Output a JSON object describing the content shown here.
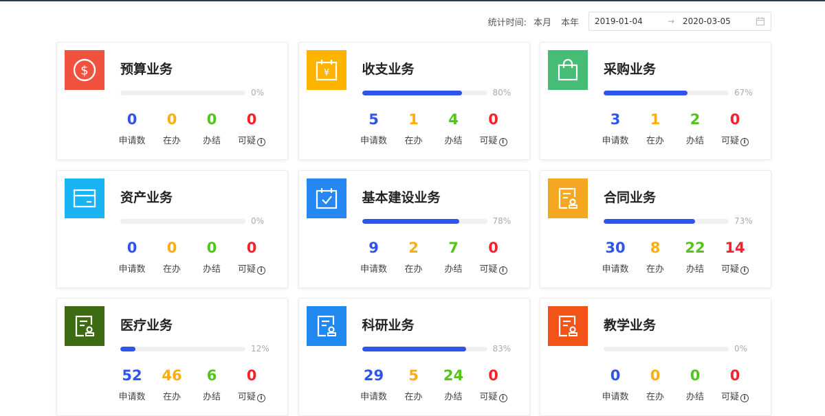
{
  "filter": {
    "label": "统计时间:",
    "options": [
      "本月",
      "本年"
    ],
    "start_date": "2019-01-04",
    "arrow": "→",
    "end_date": "2020-03-05"
  },
  "stat_labels": {
    "apply": "申请数",
    "doing": "在办",
    "done": "办结",
    "doubt": "可疑",
    "info_glyph": "i"
  },
  "colors": {
    "blue": "#2f54eb",
    "orange": "#faad14",
    "green": "#52c41a",
    "red": "#f5222d"
  },
  "cards": [
    {
      "title": "预算业务",
      "icon": "dollar-circle-icon",
      "icon_bg": "#f0523f",
      "percent": 0,
      "percent_label": "0%",
      "apply": "0",
      "doing": "0",
      "done": "0",
      "doubt": "0"
    },
    {
      "title": "收支业务",
      "icon": "yen-calendar-icon",
      "icon_bg": "#fdb400",
      "percent": 80,
      "percent_label": "80%",
      "apply": "5",
      "doing": "1",
      "done": "4",
      "doubt": "0"
    },
    {
      "title": "采购业务",
      "icon": "shopping-bag-icon",
      "icon_bg": "#46bc76",
      "percent": 67,
      "percent_label": "67%",
      "apply": "3",
      "doing": "1",
      "done": "2",
      "doubt": "0"
    },
    {
      "title": "资产业务",
      "icon": "card-icon",
      "icon_bg": "#1ab4f5",
      "percent": 0,
      "percent_label": "0%",
      "apply": "0",
      "doing": "0",
      "done": "0",
      "doubt": "0"
    },
    {
      "title": "基本建设业务",
      "icon": "calendar-check-icon",
      "icon_bg": "#2588f2",
      "percent": 78,
      "percent_label": "78%",
      "apply": "9",
      "doing": "2",
      "done": "7",
      "doubt": "0"
    },
    {
      "title": "合同业务",
      "icon": "contract-icon",
      "icon_bg": "#f5a623",
      "percent": 73,
      "percent_label": "73%",
      "apply": "30",
      "doing": "8",
      "done": "22",
      "doubt": "14"
    },
    {
      "title": "医疗业务",
      "icon": "contract-icon",
      "icon_bg": "#3d6b12",
      "percent": 12,
      "percent_label": "12%",
      "apply": "52",
      "doing": "46",
      "done": "6",
      "doubt": "0"
    },
    {
      "title": "科研业务",
      "icon": "contract-icon",
      "icon_bg": "#2188f0",
      "percent": 83,
      "percent_label": "83%",
      "apply": "29",
      "doing": "5",
      "done": "24",
      "doubt": "0"
    },
    {
      "title": "教学业务",
      "icon": "contract-icon",
      "icon_bg": "#f25417",
      "percent": 0,
      "percent_label": "0%",
      "apply": "0",
      "doing": "0",
      "done": "0",
      "doubt": "0"
    }
  ]
}
